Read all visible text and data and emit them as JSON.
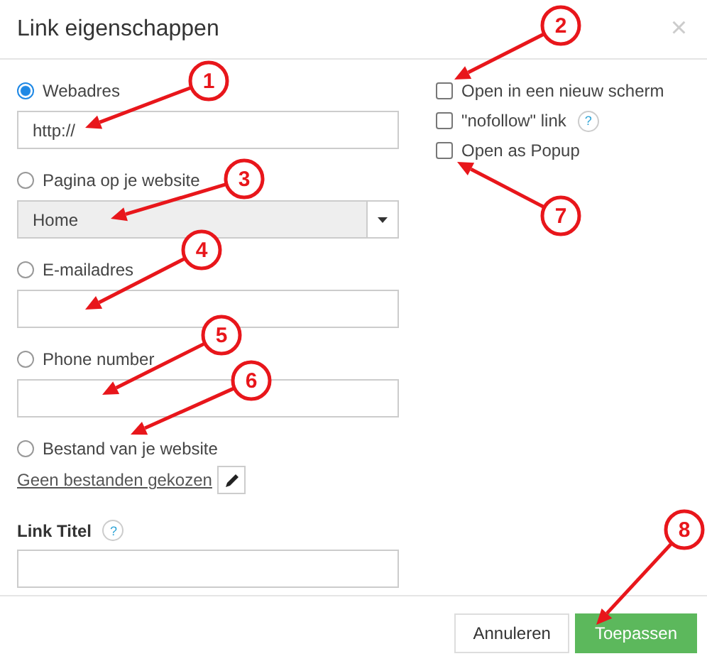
{
  "dialog": {
    "title": "Link eigenschappen",
    "close": "×"
  },
  "link_types": [
    {
      "label": "Webadres",
      "selected": true,
      "kind": "input",
      "value": "http://"
    },
    {
      "label": "Pagina op je website",
      "selected": false,
      "kind": "select",
      "value": "Home"
    },
    {
      "label": "E-mailadres",
      "selected": false,
      "kind": "input"
    },
    {
      "label": "Phone number",
      "selected": false,
      "kind": "input"
    },
    {
      "label": "Bestand van je website",
      "selected": false,
      "kind": "file",
      "file_link": "Geen bestanden gekozen"
    }
  ],
  "link_title": {
    "label": "Link Titel",
    "help": "?"
  },
  "options": [
    {
      "label": "Open in een nieuw scherm",
      "checked": false
    },
    {
      "label": "\"nofollow\" link",
      "checked": false,
      "help": "?"
    },
    {
      "label": "Open as Popup",
      "checked": false
    }
  ],
  "buttons": [
    {
      "label": "Annuleren",
      "kind": "secondary"
    },
    {
      "label": "Toepassen",
      "kind": "primary"
    }
  ],
  "callouts": [
    "1",
    "2",
    "3",
    "4",
    "5",
    "6",
    "7",
    "8"
  ]
}
